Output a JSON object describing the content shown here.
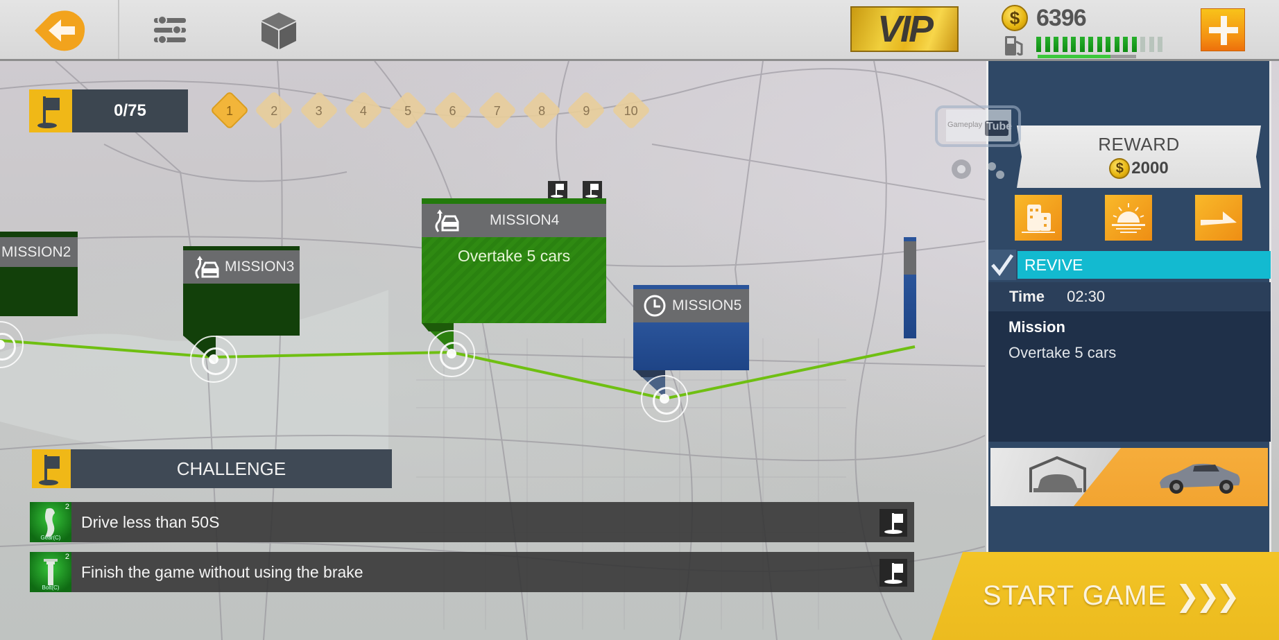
{
  "topbar": {
    "back_icon": "arrow-left-icon",
    "settings_icon": "sliders-icon",
    "garage_icon": "cube-icon",
    "vip_label": "VIP",
    "coins": "6396",
    "coin_symbol": "$",
    "fuel": {
      "filled_segments": 12,
      "total_segments": 15,
      "fill_fraction": 0.74
    },
    "add_icon": "plus-icon"
  },
  "progress": {
    "flag_icon": "flag-icon",
    "value": "0/75",
    "stages": [
      "1",
      "2",
      "3",
      "4",
      "5",
      "6",
      "7",
      "8",
      "9",
      "10"
    ],
    "active_stage": "1"
  },
  "missions": [
    {
      "id": "mission2",
      "label": "MISSION2",
      "icon": "",
      "status": "completed",
      "description": ""
    },
    {
      "id": "mission3",
      "label": "MISSION3",
      "icon": "overtake-car-icon",
      "status": "completed",
      "description": ""
    },
    {
      "id": "mission4",
      "label": "MISSION4",
      "icon": "overtake-car-icon",
      "status": "selected",
      "description": "Overtake 5 cars",
      "flags": 2
    },
    {
      "id": "mission5",
      "label": "MISSION5",
      "icon": "clock-icon",
      "status": "unlocked",
      "description": ""
    },
    {
      "id": "mission6",
      "label": "",
      "icon": "",
      "status": "unlocked",
      "description": ""
    }
  ],
  "challenge": {
    "title": "CHALLENGE",
    "items": [
      {
        "text": "Drive less than 50S",
        "count": "2",
        "caption": "Gear(C)"
      },
      {
        "text": "Finish the game without using the brake",
        "count": "2",
        "caption": "Bolt(C)"
      }
    ]
  },
  "panel": {
    "reward_label": "REWARD",
    "reward_amount": "2000",
    "conditions": [
      "city-icon",
      "sunrise-icon",
      "arrow-right-icon"
    ],
    "revive_label": "REVIVE",
    "revive_checked": true,
    "time_label": "Time",
    "time_value": "02:30",
    "mission_label": "Mission",
    "mission_value": "Overtake 5 cars"
  },
  "start_button": {
    "label": "START GAME",
    "chevrons": "❯❯❯"
  },
  "watermark": {
    "text_left": "Gameplay",
    "text_right": "Tube"
  },
  "colors": {
    "accent_orange": "#f49012",
    "accent_yellow": "#f0b817",
    "panel_blue": "#2f4866",
    "revive_cyan": "#13bad0",
    "route_green": "#6fbf12",
    "mission_green": "#2f8a12",
    "mission_blue": "#2a549a"
  }
}
